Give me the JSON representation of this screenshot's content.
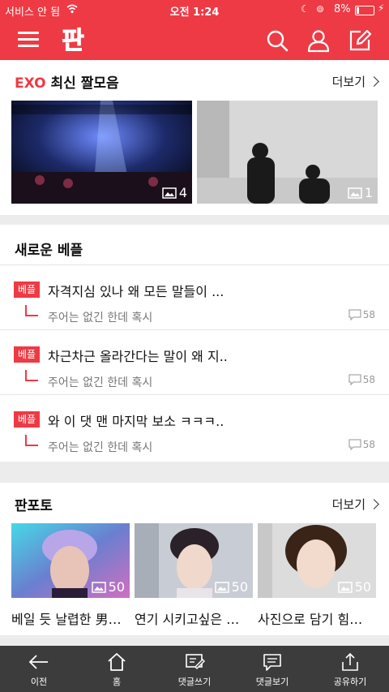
{
  "status_bar": {
    "carrier": "서비스 안 됨",
    "time": "오전 1:24",
    "battery_percent": "8%"
  },
  "header": {
    "logo_text": "판",
    "icons": [
      "menu-icon",
      "search-icon",
      "user-icon",
      "write-icon"
    ]
  },
  "clips": {
    "title_prefix": "EXO",
    "title": "최신 짤모음",
    "more_label": "더보기",
    "items": [
      {
        "count": "4"
      },
      {
        "count": "1"
      }
    ]
  },
  "new_best": {
    "title": "새로운 베플",
    "items": [
      {
        "badge": "베플",
        "title": "자격지심 있나 왜 모든 말들이 ...",
        "reply": "주어는 없긴 한데 혹시",
        "comments": "58"
      },
      {
        "badge": "베플",
        "title": "차근차근 올라간다는 말이 왜 지..",
        "reply": "주어는 없긴 한데 혹시",
        "comments": "58"
      },
      {
        "badge": "베플",
        "title": "와 이 댓 맨 마지막 보소 ㅋㅋㅋ..",
        "reply": "주어는 없긴 한데 혹시",
        "comments": "58"
      }
    ]
  },
  "pan_photo": {
    "title": "판포토",
    "more_label": "더보기",
    "items": [
      {
        "count": "50",
        "caption": "베일 듯 날렵한 男…"
      },
      {
        "count": "50",
        "caption": "연기 시키고싶은 …"
      },
      {
        "count": "50",
        "caption": "사진으로 담기 힘…"
      }
    ]
  },
  "bottom_nav": [
    {
      "label": "이전",
      "icon": "back-arrow-icon"
    },
    {
      "label": "홈",
      "icon": "home-icon"
    },
    {
      "label": "댓글쓰기",
      "icon": "write-comment-icon"
    },
    {
      "label": "댓글보기",
      "icon": "view-comments-icon"
    },
    {
      "label": "공유하기",
      "icon": "share-icon"
    }
  ],
  "colors": {
    "brand_red": "#ee3a44",
    "bottom_bar": "#3c3c3c"
  }
}
